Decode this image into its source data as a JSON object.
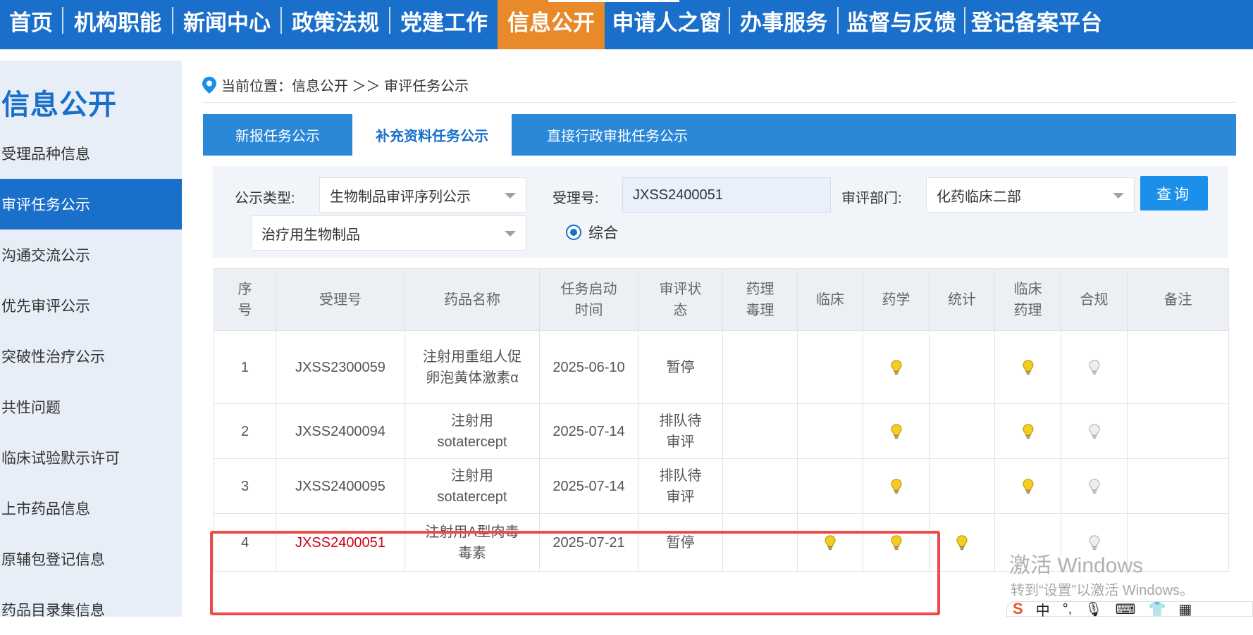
{
  "nav": {
    "items": [
      "首页",
      "机构职能",
      "新闻中心",
      "政策法规",
      "党建工作",
      "信息公开",
      "申请人之窗",
      "办事服务",
      "监督与反馈",
      "登记备案平台"
    ],
    "active_index": 5
  },
  "sidebar": {
    "title": "信息公开",
    "items": [
      "受理品种信息",
      "审评任务公示",
      "沟通交流公示",
      "优先审评公示",
      "突破性治疗公示",
      "共性问题",
      "临床试验默示许可",
      "上市药品信息",
      "原辅包登记信息",
      "药品目录集信息"
    ],
    "active_index": 1
  },
  "breadcrumb": {
    "prefix": "当前位置：",
    "path": "信息公开 ＞＞ 审评任务公示"
  },
  "tabs": [
    "新报任务公示",
    "补充资料任务公示",
    "直接行政审批任务公示"
  ],
  "filter": {
    "type_label": "公示类型:",
    "type_value": "生物制品审评序列公示",
    "subtype_value": "治疗用生物制品",
    "acceptance_label": "受理号:",
    "acceptance_value": "JXSS2400051",
    "dept_label": "审评部门:",
    "dept_value": "化药临床二部",
    "query_button": "查询",
    "radio_label": "综合"
  },
  "table": {
    "headers": [
      "序号",
      "受理号",
      "药品名称",
      "任务启动时间",
      "审评状态",
      "药理毒理",
      "临床",
      "药学",
      "统计",
      "临床药理",
      "合规",
      "备注"
    ],
    "rows": [
      {
        "no": "1",
        "id": "JXSS2300059",
        "name": "注射用重组人促卵泡黄体激素α",
        "date": "2025-06-10",
        "status": "暂停",
        "bulbs": [
          "",
          "",
          "on",
          "",
          "on",
          "off"
        ]
      },
      {
        "no": "2",
        "id": "JXSS2400094",
        "name": "注射用 sotatercept",
        "date": "2025-07-14",
        "status": "排队待审评",
        "bulbs": [
          "",
          "",
          "on",
          "",
          "on",
          "off"
        ]
      },
      {
        "no": "3",
        "id": "JXSS2400095",
        "name": "注射用 sotatercept",
        "date": "2025-07-14",
        "status": "排队待审评",
        "bulbs": [
          "",
          "",
          "on",
          "",
          "on",
          "off"
        ]
      },
      {
        "no": "4",
        "id": "JXSS2400051",
        "name": "注射用A型肉毒毒素",
        "date": "2025-07-21",
        "status": "暂停",
        "bulbs": [
          "",
          "on",
          "on",
          "on",
          "",
          "off"
        ],
        "highlight_id": true
      }
    ]
  },
  "watermark": {
    "line1": "激活 Windows",
    "line2": "转到“设置”以激活 Windows。"
  },
  "ime": {
    "logo": "S",
    "mode": "中"
  },
  "colors": {
    "nav_bg": "#1a6fca",
    "nav_active": "#e8892a",
    "tab_bg": "#2b87d8",
    "highlight": "#ee4a4a",
    "bulb_on": "#f2c21b",
    "bulb_off": "#c9c9c9"
  }
}
